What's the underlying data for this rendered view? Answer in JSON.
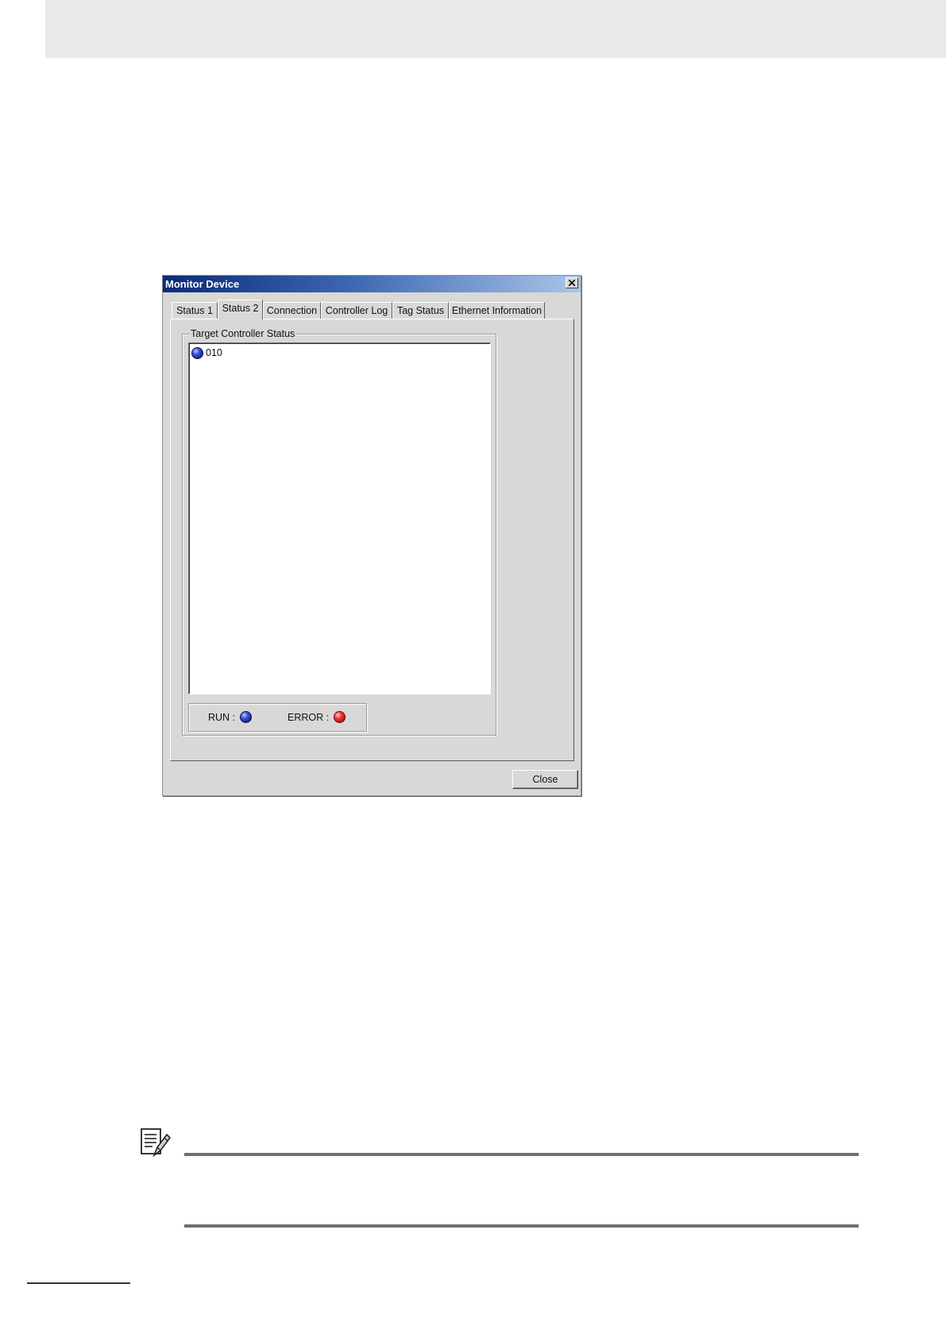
{
  "dialog": {
    "title": "Monitor Device",
    "tabs": [
      {
        "label": "Status 1",
        "active": false
      },
      {
        "label": "Status 2",
        "active": true
      },
      {
        "label": "Connection",
        "active": false
      },
      {
        "label": "Controller Log",
        "active": false
      },
      {
        "label": "Tag Status",
        "active": false
      },
      {
        "label": "Ethernet Information",
        "active": false
      }
    ],
    "group_title": "Target Controller Status",
    "tree_items": [
      {
        "label": "010",
        "status": "run",
        "icon": "blue-led-icon"
      }
    ],
    "legend": {
      "run_label": "RUN :",
      "error_label": "ERROR :"
    },
    "close_button_label": "Close"
  },
  "colors": {
    "run": "#2a3fbf",
    "error": "#e0262b",
    "titlebar_start": "#0b2a7a",
    "titlebar_end": "#a9c5e8",
    "dialog_bg": "#d9d8d6"
  },
  "note": {
    "icon": "note-pencil-icon"
  }
}
